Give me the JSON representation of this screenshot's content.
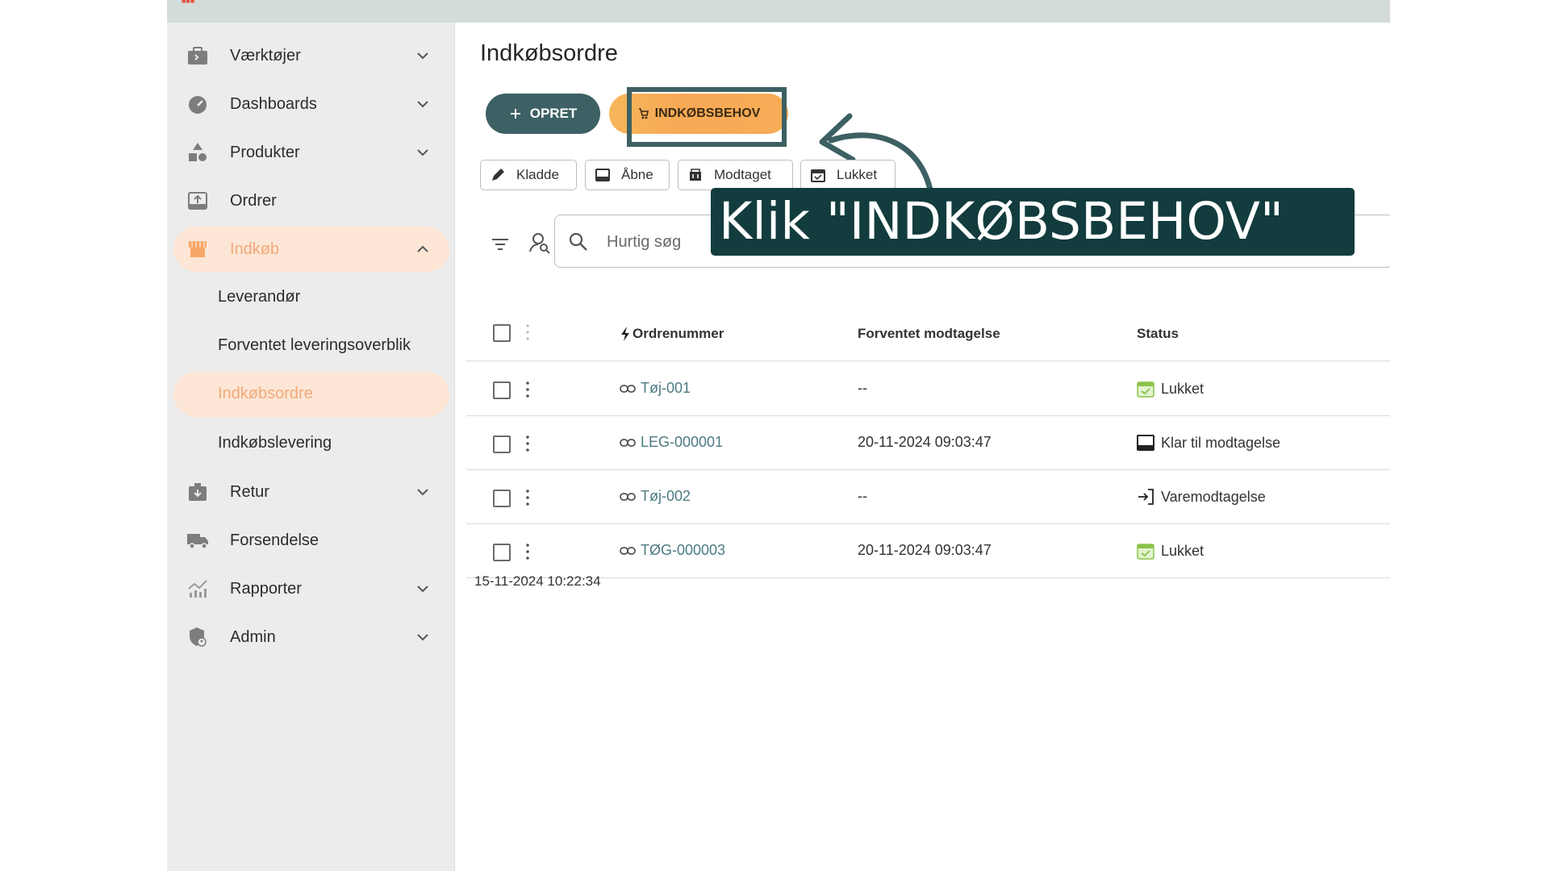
{
  "sidebar": {
    "items": [
      {
        "label": "Værktøjer",
        "icon": "toolbox-icon"
      },
      {
        "label": "Dashboards",
        "icon": "gauge-icon"
      },
      {
        "label": "Produkter",
        "icon": "shapes-icon"
      },
      {
        "label": "Ordrer",
        "icon": "inbox-upload-icon"
      },
      {
        "label": "Indkøb",
        "icon": "store-icon"
      },
      {
        "label": "Retur",
        "icon": "return-box-icon"
      },
      {
        "label": "Forsendelse",
        "icon": "truck-icon"
      },
      {
        "label": "Rapporter",
        "icon": "chart-icon"
      },
      {
        "label": "Admin",
        "icon": "shield-user-icon"
      }
    ],
    "sub_items": [
      {
        "label": "Leverandør"
      },
      {
        "label": "Forventet leveringsoverblik"
      },
      {
        "label": "Indkøbsordre"
      },
      {
        "label": "Indkøbslevering"
      }
    ]
  },
  "page": {
    "title": "Indkøbsordre",
    "btn_opret": "OPRET",
    "btn_behov": "INDKØBSBEHOV",
    "callout": "Klik \"INDKØBSBEHOV\"",
    "chips": [
      {
        "label": "Kladde",
        "icon": "pencil-icon"
      },
      {
        "label": "Åbne",
        "icon": "inbox-icon"
      },
      {
        "label": "Modtaget",
        "icon": "receive-icon"
      },
      {
        "label": "Lukket",
        "icon": "calendar-check-icon"
      }
    ],
    "search_placeholder": "Hurtig søg",
    "footer_date": "15-11-2024 10:22:34"
  },
  "table": {
    "headers": {
      "order": "Ordrenummer",
      "expected": "Forventet modtagelse",
      "status": "Status"
    },
    "rows": [
      {
        "order": "Tøj-001",
        "expected": "--",
        "status": "Lukket",
        "status_icon": "calendar-check-icon"
      },
      {
        "order": "LEG-000001",
        "expected": "20-11-2024 09:03:47",
        "status": "Klar til modtagelse",
        "status_icon": "inbox-icon"
      },
      {
        "order": "Tøj-002",
        "expected": "--",
        "status": "Varemodtagelse",
        "status_icon": "login-icon"
      },
      {
        "order": "TØG-000003",
        "expected": "20-11-2024 09:03:47",
        "status": "Lukket",
        "status_icon": "calendar-check-icon"
      }
    ]
  },
  "colors": {
    "accent_teal": "#3d6064",
    "accent_orange": "#f6b65a",
    "active_bg": "#fde6d6",
    "callout_bg": "#123c3d"
  }
}
